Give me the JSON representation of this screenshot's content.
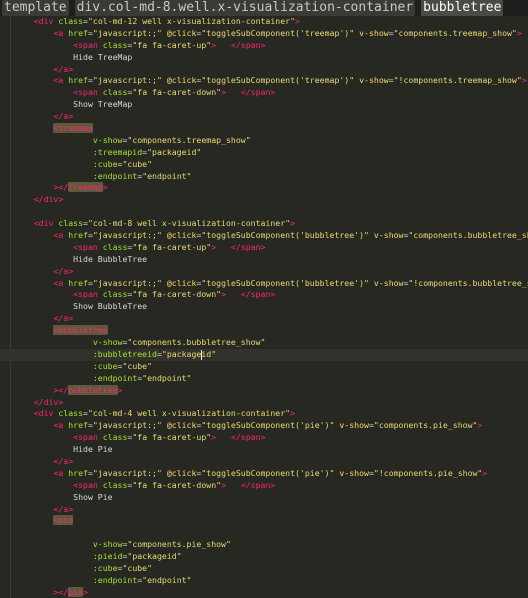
{
  "breadcrumb": [
    {
      "label": "template",
      "active": false
    },
    {
      "label": "div.col-md-8.well.x-visualization-container",
      "active": false
    },
    {
      "label": "bubbletree",
      "active": true
    }
  ],
  "cursor_line": 28,
  "lines": [
    {
      "g": "",
      "t": [
        [
          "txt",
          "    "
        ],
        [
          "tag",
          "<div"
        ],
        [
          "txt",
          " "
        ],
        [
          "attr",
          "class"
        ],
        [
          "txt",
          "="
        ],
        [
          "str",
          "\"col-md-12 well x-visualization-container\""
        ],
        [
          "tag",
          ">"
        ]
      ]
    },
    {
      "g": "",
      "t": [
        [
          "txt",
          "        "
        ],
        [
          "tag",
          "<a"
        ],
        [
          "txt",
          " "
        ],
        [
          "attr",
          "href"
        ],
        [
          "txt",
          "="
        ],
        [
          "str",
          "\"javascript:;\""
        ],
        [
          "txt",
          " "
        ],
        [
          "dir",
          "@click"
        ],
        [
          "txt",
          "="
        ],
        [
          "str",
          "\"toggleSubComponent('treemap')\""
        ],
        [
          "txt",
          " "
        ],
        [
          "dir",
          "v-show"
        ],
        [
          "txt",
          "="
        ],
        [
          "str",
          "\"components.treemap_show\""
        ],
        [
          "tag",
          ">"
        ]
      ]
    },
    {
      "g": "",
      "t": [
        [
          "txt",
          "            "
        ],
        [
          "tag",
          "<span"
        ],
        [
          "txt",
          " "
        ],
        [
          "attr",
          "class"
        ],
        [
          "txt",
          "="
        ],
        [
          "str",
          "\"fa fa-caret-up\""
        ],
        [
          "tag",
          ">"
        ],
        [
          "txt",
          "   "
        ],
        [
          "tag",
          "</span>"
        ]
      ]
    },
    {
      "g": "",
      "t": [
        [
          "txt",
          "            Hide TreeMap"
        ]
      ]
    },
    {
      "g": "",
      "t": [
        [
          "txt",
          "        "
        ],
        [
          "tag",
          "</a>"
        ]
      ]
    },
    {
      "g": "",
      "t": [
        [
          "txt",
          "        "
        ],
        [
          "tag",
          "<a"
        ],
        [
          "txt",
          " "
        ],
        [
          "attr",
          "href"
        ],
        [
          "txt",
          "="
        ],
        [
          "str",
          "\"javascript:;\""
        ],
        [
          "txt",
          " "
        ],
        [
          "dir",
          "@click"
        ],
        [
          "txt",
          "="
        ],
        [
          "str",
          "\"toggleSubComponent('treemap')\""
        ],
        [
          "txt",
          " "
        ],
        [
          "dir",
          "v-show"
        ],
        [
          "txt",
          "="
        ],
        [
          "str",
          "\"!components.treemap_show\""
        ],
        [
          "tag",
          ">"
        ]
      ]
    },
    {
      "g": "",
      "t": [
        [
          "txt",
          "            "
        ],
        [
          "tag",
          "<span"
        ],
        [
          "txt",
          " "
        ],
        [
          "attr",
          "class"
        ],
        [
          "txt",
          "="
        ],
        [
          "str",
          "\"fa fa-caret-down\""
        ],
        [
          "tag",
          ">"
        ],
        [
          "txt",
          "   "
        ],
        [
          "tag",
          "</span>"
        ]
      ]
    },
    {
      "g": "",
      "t": [
        [
          "txt",
          "            Show TreeMap"
        ]
      ]
    },
    {
      "g": "",
      "t": [
        [
          "txt",
          "        "
        ],
        [
          "tag",
          "</a>"
        ]
      ]
    },
    {
      "g": "",
      "t": [
        [
          "txt",
          "        "
        ],
        [
          "hl",
          "<treemap"
        ]
      ]
    },
    {
      "g": "",
      "t": [
        [
          "txt",
          "                "
        ],
        [
          "attr",
          "v-show"
        ],
        [
          "txt",
          "="
        ],
        [
          "str",
          "\"components.treemap_show\""
        ]
      ]
    },
    {
      "g": "",
      "t": [
        [
          "txt",
          "                "
        ],
        [
          "attr",
          ":treemapid"
        ],
        [
          "txt",
          "="
        ],
        [
          "str",
          "\"packageid\""
        ]
      ]
    },
    {
      "g": "",
      "t": [
        [
          "txt",
          "                "
        ],
        [
          "attr",
          ":cube"
        ],
        [
          "txt",
          "="
        ],
        [
          "str",
          "\"cube\""
        ]
      ]
    },
    {
      "g": "",
      "t": [
        [
          "txt",
          "                "
        ],
        [
          "attr",
          ":endpoint"
        ],
        [
          "txt",
          "="
        ],
        [
          "str",
          "\"endpoint\""
        ]
      ]
    },
    {
      "g": "",
      "t": [
        [
          "txt",
          "        "
        ],
        [
          "tag",
          "></"
        ],
        [
          "hl",
          "treemap"
        ],
        [
          "tag",
          ">"
        ]
      ]
    },
    {
      "g": "",
      "t": [
        [
          "txt",
          "    "
        ],
        [
          "tag",
          "</div>"
        ]
      ]
    },
    {
      "g": "",
      "t": [
        [
          "txt",
          ""
        ]
      ]
    },
    {
      "g": "",
      "t": [
        [
          "txt",
          "    "
        ],
        [
          "tag",
          "<div"
        ],
        [
          "txt",
          " "
        ],
        [
          "attr",
          "class"
        ],
        [
          "txt",
          "="
        ],
        [
          "str",
          "\"col-md-8 well x-visualization-container\""
        ],
        [
          "tag",
          ">"
        ]
      ]
    },
    {
      "g": "",
      "t": [
        [
          "txt",
          "        "
        ],
        [
          "tag",
          "<a"
        ],
        [
          "txt",
          " "
        ],
        [
          "attr",
          "href"
        ],
        [
          "txt",
          "="
        ],
        [
          "str",
          "\"javascript:;\""
        ],
        [
          "txt",
          " "
        ],
        [
          "dir",
          "@click"
        ],
        [
          "txt",
          "="
        ],
        [
          "str",
          "\"toggleSubComponent('bubbletree')\""
        ],
        [
          "txt",
          " "
        ],
        [
          "dir",
          "v-show"
        ],
        [
          "txt",
          "="
        ],
        [
          "str",
          "\"components.bubbletree_sh"
        ]
      ]
    },
    {
      "g": "",
      "t": [
        [
          "txt",
          "            "
        ],
        [
          "tag",
          "<span"
        ],
        [
          "txt",
          " "
        ],
        [
          "attr",
          "class"
        ],
        [
          "txt",
          "="
        ],
        [
          "str",
          "\"fa fa-caret-up\""
        ],
        [
          "tag",
          ">"
        ],
        [
          "txt",
          "   "
        ],
        [
          "tag",
          "</span>"
        ]
      ]
    },
    {
      "g": "",
      "t": [
        [
          "txt",
          "            Hide BubbleTree"
        ]
      ]
    },
    {
      "g": "",
      "t": [
        [
          "txt",
          "        "
        ],
        [
          "tag",
          "</a>"
        ]
      ]
    },
    {
      "g": "",
      "t": [
        [
          "txt",
          "        "
        ],
        [
          "tag",
          "<a"
        ],
        [
          "txt",
          " "
        ],
        [
          "attr",
          "href"
        ],
        [
          "txt",
          "="
        ],
        [
          "str",
          "\"javascript:;\""
        ],
        [
          "txt",
          " "
        ],
        [
          "dir",
          "@click"
        ],
        [
          "txt",
          "="
        ],
        [
          "str",
          "\"toggleSubComponent('bubbletree')\""
        ],
        [
          "txt",
          " "
        ],
        [
          "dir",
          "v-show"
        ],
        [
          "txt",
          "="
        ],
        [
          "str",
          "\"!components.bubbletree_s"
        ]
      ]
    },
    {
      "g": "",
      "t": [
        [
          "txt",
          "            "
        ],
        [
          "tag",
          "<span"
        ],
        [
          "txt",
          " "
        ],
        [
          "attr",
          "class"
        ],
        [
          "txt",
          "="
        ],
        [
          "str",
          "\"fa fa-caret-down\""
        ],
        [
          "tag",
          ">"
        ],
        [
          "txt",
          "   "
        ],
        [
          "tag",
          "</span>"
        ]
      ]
    },
    {
      "g": "",
      "t": [
        [
          "txt",
          "            Show BubbleTree"
        ]
      ]
    },
    {
      "g": "",
      "t": [
        [
          "txt",
          "        "
        ],
        [
          "tag",
          "</a>"
        ]
      ]
    },
    {
      "g": "",
      "t": [
        [
          "txt",
          "        "
        ],
        [
          "hl",
          "<bubbletree"
        ]
      ]
    },
    {
      "g": "",
      "t": [
        [
          "txt",
          "                "
        ],
        [
          "attr",
          "v-show"
        ],
        [
          "txt",
          "="
        ],
        [
          "str",
          "\"components.bubbletree_show\""
        ]
      ]
    },
    {
      "g": "",
      "t": [
        [
          "txt",
          "                "
        ],
        [
          "attr",
          ":bubbletreeid"
        ],
        [
          "txt",
          "="
        ],
        [
          "str",
          "\"packageid\""
        ]
      ]
    },
    {
      "g": "",
      "t": [
        [
          "txt",
          "                "
        ],
        [
          "attr",
          ":cube"
        ],
        [
          "txt",
          "="
        ],
        [
          "str",
          "\"cube\""
        ]
      ]
    },
    {
      "g": "",
      "t": [
        [
          "txt",
          "                "
        ],
        [
          "attr",
          ":endpoint"
        ],
        [
          "txt",
          "="
        ],
        [
          "str",
          "\"endpoint\""
        ]
      ]
    },
    {
      "g": "",
      "t": [
        [
          "txt",
          "        "
        ],
        [
          "tag",
          "></"
        ],
        [
          "hl",
          "bubbletree"
        ],
        [
          "tag",
          ">"
        ]
      ]
    },
    {
      "g": "",
      "t": [
        [
          "txt",
          "    "
        ],
        [
          "tag",
          "</div>"
        ]
      ]
    },
    {
      "g": "",
      "t": [
        [
          "txt",
          "    "
        ],
        [
          "tag",
          "<div"
        ],
        [
          "txt",
          " "
        ],
        [
          "attr",
          "class"
        ],
        [
          "txt",
          "="
        ],
        [
          "str",
          "\"col-md-4 well x-visualization-container\""
        ],
        [
          "tag",
          ">"
        ]
      ]
    },
    {
      "g": "",
      "t": [
        [
          "txt",
          "        "
        ],
        [
          "tag",
          "<a"
        ],
        [
          "txt",
          " "
        ],
        [
          "attr",
          "href"
        ],
        [
          "txt",
          "="
        ],
        [
          "str",
          "\"javascript:;\""
        ],
        [
          "txt",
          " "
        ],
        [
          "dir",
          "@click"
        ],
        [
          "txt",
          "="
        ],
        [
          "str",
          "\"toggleSubComponent('pie')\""
        ],
        [
          "txt",
          " "
        ],
        [
          "dir",
          "v-show"
        ],
        [
          "txt",
          "="
        ],
        [
          "str",
          "\"components.pie_show\""
        ],
        [
          "tag",
          ">"
        ]
      ]
    },
    {
      "g": "",
      "t": [
        [
          "txt",
          "            "
        ],
        [
          "tag",
          "<span"
        ],
        [
          "txt",
          " "
        ],
        [
          "attr",
          "class"
        ],
        [
          "txt",
          "="
        ],
        [
          "str",
          "\"fa fa-caret-up\""
        ],
        [
          "tag",
          ">"
        ],
        [
          "txt",
          "   "
        ],
        [
          "tag",
          "</span>"
        ]
      ]
    },
    {
      "g": "",
      "t": [
        [
          "txt",
          "            Hide Pie"
        ]
      ]
    },
    {
      "g": "",
      "t": [
        [
          "txt",
          "        "
        ],
        [
          "tag",
          "</a>"
        ]
      ]
    },
    {
      "g": "",
      "t": [
        [
          "txt",
          "        "
        ],
        [
          "tag",
          "<a"
        ],
        [
          "txt",
          " "
        ],
        [
          "attr",
          "href"
        ],
        [
          "txt",
          "="
        ],
        [
          "str",
          "\"javascript:;\""
        ],
        [
          "txt",
          " "
        ],
        [
          "dir",
          "@click"
        ],
        [
          "txt",
          "="
        ],
        [
          "str",
          "\"toggleSubComponent('pie')\""
        ],
        [
          "txt",
          " "
        ],
        [
          "dir",
          "v-show"
        ],
        [
          "txt",
          "="
        ],
        [
          "str",
          "\"!components.pie_show\""
        ],
        [
          "tag",
          ">"
        ]
      ]
    },
    {
      "g": "",
      "t": [
        [
          "txt",
          "            "
        ],
        [
          "tag",
          "<span"
        ],
        [
          "txt",
          " "
        ],
        [
          "attr",
          "class"
        ],
        [
          "txt",
          "="
        ],
        [
          "str",
          "\"fa fa-caret-down\""
        ],
        [
          "tag",
          ">"
        ],
        [
          "txt",
          "   "
        ],
        [
          "tag",
          "</span>"
        ]
      ]
    },
    {
      "g": "",
      "t": [
        [
          "txt",
          "            Show Pie"
        ]
      ]
    },
    {
      "g": "",
      "t": [
        [
          "txt",
          "        "
        ],
        [
          "tag",
          "</a>"
        ]
      ]
    },
    {
      "g": "",
      "t": [
        [
          "txt",
          "        "
        ],
        [
          "hl",
          "<pie"
        ]
      ]
    },
    {
      "g": "",
      "t": [
        [
          "txt",
          ""
        ]
      ]
    },
    {
      "g": "",
      "t": [
        [
          "txt",
          "                "
        ],
        [
          "attr",
          "v-show"
        ],
        [
          "txt",
          "="
        ],
        [
          "str",
          "\"components.pie_show\""
        ]
      ]
    },
    {
      "g": "",
      "t": [
        [
          "txt",
          "                "
        ],
        [
          "attr",
          ":pieid"
        ],
        [
          "txt",
          "="
        ],
        [
          "str",
          "\"packageid\""
        ]
      ]
    },
    {
      "g": "",
      "t": [
        [
          "txt",
          "                "
        ],
        [
          "attr",
          ":cube"
        ],
        [
          "txt",
          "="
        ],
        [
          "str",
          "\"cube\""
        ]
      ]
    },
    {
      "g": "",
      "t": [
        [
          "txt",
          "                "
        ],
        [
          "attr",
          ":endpoint"
        ],
        [
          "txt",
          "="
        ],
        [
          "str",
          "\"endpoint\""
        ]
      ]
    },
    {
      "g": "",
      "t": [
        [
          "txt",
          "        "
        ],
        [
          "tag",
          "></"
        ],
        [
          "hl",
          "pie"
        ],
        [
          "tag",
          ">"
        ]
      ]
    }
  ],
  "colors": {
    "background": "#272822",
    "tag": "#f92672",
    "attribute": "#a6e22e",
    "directive": "#ffd866",
    "string": "#e6db74",
    "text": "#d8d8d2"
  }
}
